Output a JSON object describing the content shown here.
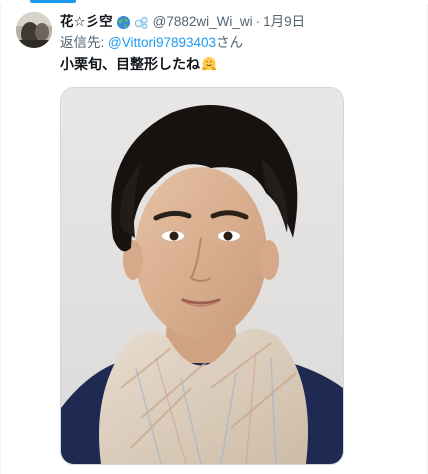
{
  "tweet": {
    "display_name": "花☆彡空",
    "handle": "@7882wi_Wi_wi",
    "separator": "·",
    "date": "1月9日",
    "reply_prefix": "返信先: ",
    "reply_to": "@Vittori97893403",
    "reply_suffix": "さん",
    "text_part1": "小",
    "text_bold": "栗旬",
    "text_part2": "、目整形したね",
    "emoji": "hugging-face-emoji"
  },
  "badges": [
    "globe-icon",
    "bubbles-icon"
  ],
  "media": {
    "type": "photo",
    "subject": "man-portrait-with-scarf"
  },
  "colors": {
    "accent": "#1d9bf0",
    "secondary_text": "#536471",
    "primary_text": "#0f1419",
    "border": "#cfd9de"
  }
}
